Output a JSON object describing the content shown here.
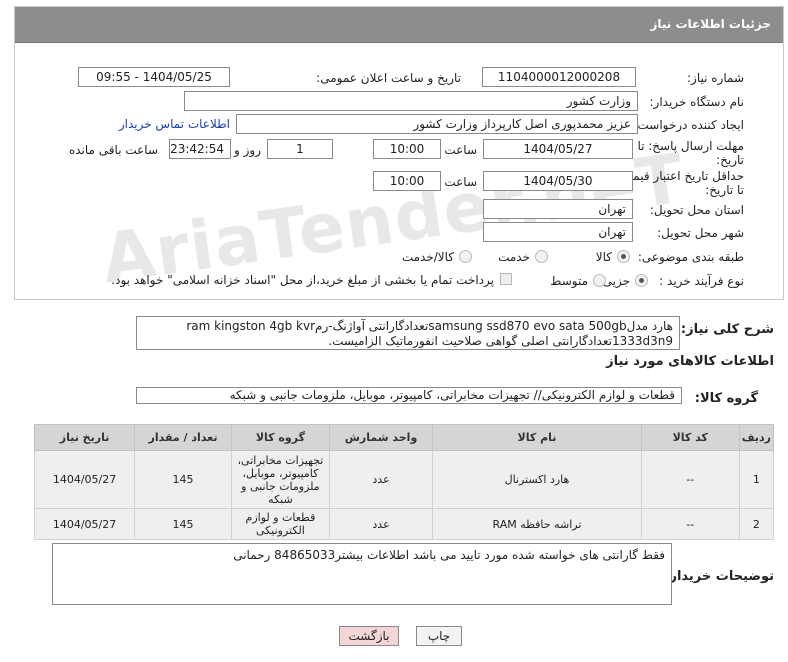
{
  "header": {
    "title": "جزئیات اطلاعات نیاز"
  },
  "form": {
    "need_number_label": "شماره نیاز:",
    "need_number": "1104000012000208",
    "announce_label": "تاریخ و ساعت اعلان عمومی:",
    "announce_value": "1404/05/25 - 09:55",
    "buyer_org_label": "نام دستگاه خریدار:",
    "buyer_org": "وزارت کشور",
    "creator_label": "ایجاد کننده درخواست:",
    "creator": "عزیز محمدپوری اصل کارپرداز وزارت کشور",
    "contact_link": "اطلاعات تماس خریدار",
    "deadline_label_1": "مهلت ارسال پاسخ: تا",
    "deadline_label_2": "تاریخ:",
    "deadline_date": "1404/05/27",
    "time_label": "ساعت",
    "deadline_time": "10:00",
    "days_value": "1",
    "days_label": "روز و",
    "remaining_time": "23:42:54",
    "remaining_label": "ساعت باقی مانده",
    "validity_label_1": "حداقل تاریخ اعتبار قیمت:",
    "validity_label_2": "تا تاریخ:",
    "validity_date": "1404/05/30",
    "validity_time": "10:00",
    "province_label": "استان محل تحویل:",
    "province": "تهران",
    "city_label": "شهر محل تحویل:",
    "city": "تهران",
    "category_label": "طبقه بندی موضوعی:",
    "category_options": [
      "کالا",
      "خدمت",
      "کالا/خدمت"
    ],
    "category_selected": "کالا",
    "process_label": "نوع فرآیند خرید :",
    "process_options": [
      "جزیی",
      "متوسط"
    ],
    "process_selected": "جزیی",
    "payment_note": "پرداخت تمام یا بخشی از مبلغ خرید،از محل \"اسناد خزانه اسلامی\" خواهد بود."
  },
  "description": {
    "label": "شرح کلی نیاز:",
    "line1": "هارد مدلsamsung ssd870 evo sata 500gbتعدادگارانتی آواژنگ-رمram kingston 4gb kvr",
    "line2": "1333d3n9تعدادگارانتی اصلی گواهی صلاحیت انفورماتیک الزامیست."
  },
  "goods_info": {
    "title": "اطلاعات کالاهای مورد نیاز",
    "group_label": "گروه کالا:",
    "group_value": "قطعات و لوازم الکترونیکی// تجهیزات مخابراتی، کامپیوتر، موبایل، ملزومات جانبی و شبکه"
  },
  "table": {
    "headers": [
      "ردیف",
      "کد کالا",
      "نام کالا",
      "واحد شمارش",
      "گروه کالا",
      "تعداد / مقدار",
      "تاریخ نیاز"
    ],
    "rows": [
      {
        "row": "1",
        "code": "--",
        "name": "هارد اکسترنال",
        "unit": "عدد",
        "group": "تجهیزات مخابراتی، کامپیوتر، موبایل، ملزومات جانبی و شبکه",
        "qty": "145",
        "date": "1404/05/27"
      },
      {
        "row": "2",
        "code": "--",
        "name": "تراشه حافظه RAM",
        "unit": "عدد",
        "group": "قطعات و لوازم الکترونیکی",
        "qty": "145",
        "date": "1404/05/27"
      }
    ]
  },
  "buyer_notes": {
    "label": "توضیحات خریدار:",
    "text": "فقط گارانتی های خواسته شده مورد تایید می باشد اطلاعات بیشتر84865033 رحمانی"
  },
  "buttons": {
    "print": "چاپ",
    "back": "بازگشت"
  },
  "watermark": "AriaTender.neT",
  "colors": {
    "header_bg": "#8d8d8d",
    "link": "#1a3fb0",
    "back_button_bg": "#f4d6d6",
    "print_button_bg": "#f3f3f3"
  }
}
